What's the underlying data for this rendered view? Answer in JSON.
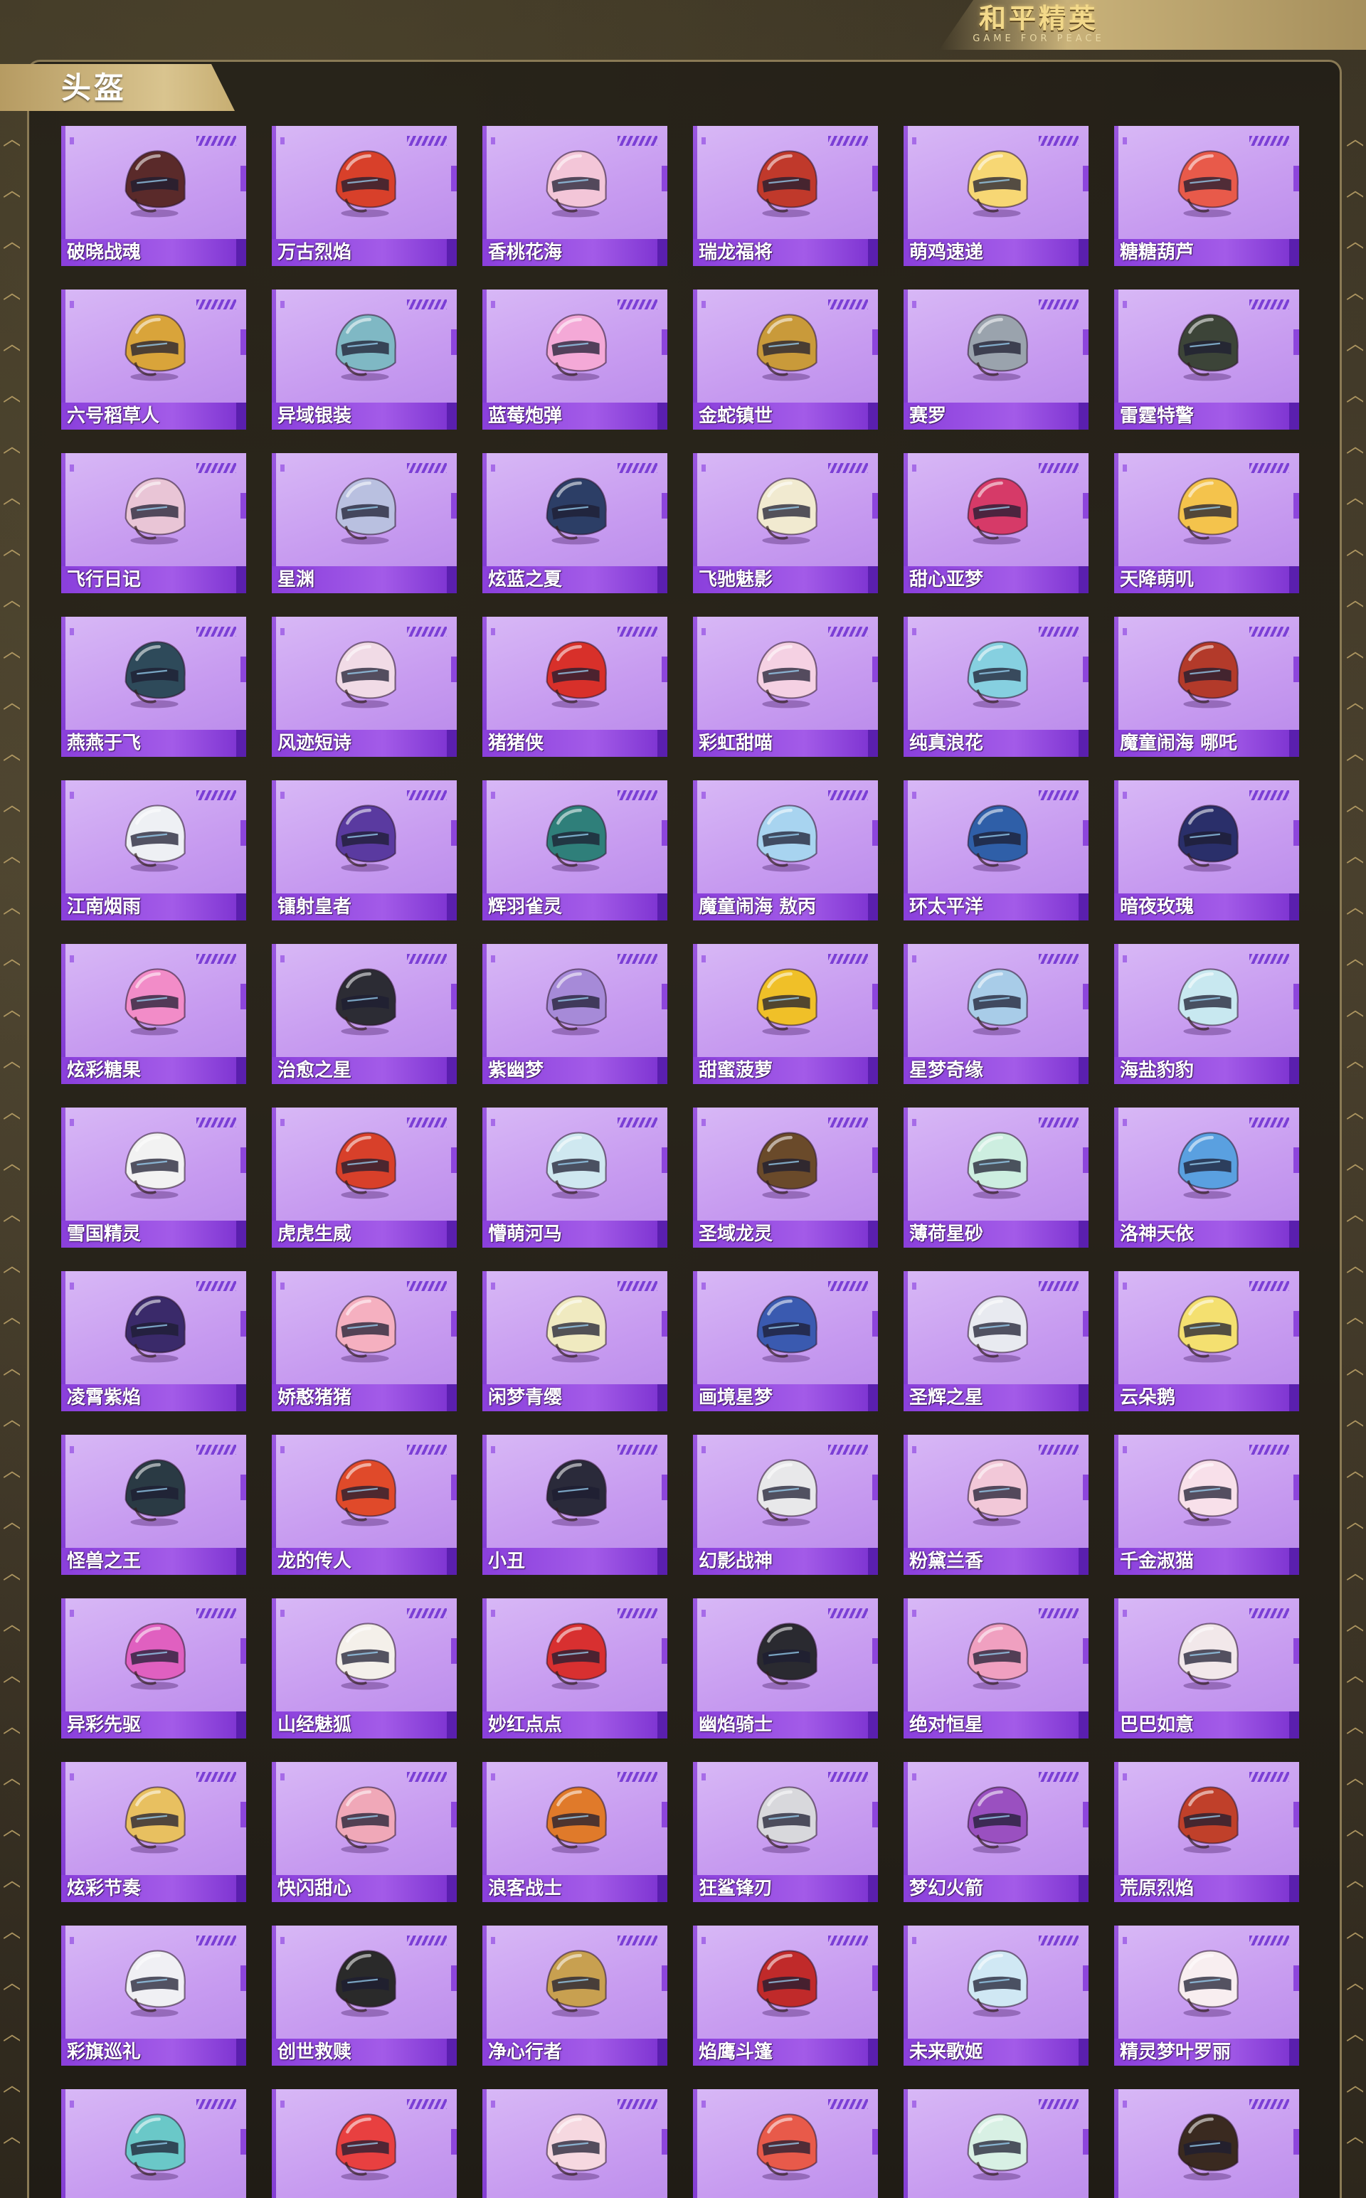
{
  "brand": {
    "name": "和平精英",
    "subtitle": "GAME FOR PEACE"
  },
  "section": {
    "title": "头盔"
  },
  "colors": {
    "card_bg": "#c99df0",
    "label_bar": "#9a4fe4",
    "tab_gold": "#d2bb84"
  },
  "items": [
    {
      "name": "破晓战魂",
      "color": "#5a2a2a"
    },
    {
      "name": "万古烈焰",
      "color": "#d8402a"
    },
    {
      "name": "香桃花海",
      "color": "#f3c6d8"
    },
    {
      "name": "瑞龙福将",
      "color": "#c0392b"
    },
    {
      "name": "萌鸡速递",
      "color": "#f7d774"
    },
    {
      "name": "糖糖葫芦",
      "color": "#e85a4a"
    },
    {
      "name": "六号稻草人",
      "color": "#d9a43a"
    },
    {
      "name": "异域银装",
      "color": "#7fb8c4"
    },
    {
      "name": "蓝莓炮弹",
      "color": "#f4a9d7"
    },
    {
      "name": "金蛇镇世",
      "color": "#c99a3a"
    },
    {
      "name": "赛罗",
      "color": "#9aa3ad"
    },
    {
      "name": "雷霆特警",
      "color": "#3c4438"
    },
    {
      "name": "飞行日记",
      "color": "#e9c5d6"
    },
    {
      "name": "星渊",
      "color": "#b9c0e0"
    },
    {
      "name": "炫蓝之夏",
      "color": "#2c3e66"
    },
    {
      "name": "飞驰魅影",
      "color": "#f1ead0"
    },
    {
      "name": "甜心亚梦",
      "color": "#d63a68"
    },
    {
      "name": "天降萌叽",
      "color": "#f4c34c"
    },
    {
      "name": "燕燕于飞",
      "color": "#2e4a5a"
    },
    {
      "name": "风迹短诗",
      "color": "#f1dbe6"
    },
    {
      "name": "猪猪侠",
      "color": "#d8302a"
    },
    {
      "name": "彩虹甜喵",
      "color": "#f5d1e3"
    },
    {
      "name": "纯真浪花",
      "color": "#86d0e0"
    },
    {
      "name": "魔童闹海 哪吒",
      "color": "#b33a2a"
    },
    {
      "name": "江南烟雨",
      "color": "#eef0f4"
    },
    {
      "name": "镭射皇者",
      "color": "#5a3aa0"
    },
    {
      "name": "辉羽雀灵",
      "color": "#2f7f7a"
    },
    {
      "name": "魔童闹海 敖丙",
      "color": "#a8d4f0"
    },
    {
      "name": "环太平洋",
      "color": "#2f5fa8"
    },
    {
      "name": "暗夜玫瑰",
      "color": "#2a2f6a"
    },
    {
      "name": "炫彩糖果",
      "color": "#f28cc8"
    },
    {
      "name": "治愈之星",
      "color": "#2c2c34"
    },
    {
      "name": "紫幽梦",
      "color": "#a68ad8"
    },
    {
      "name": "甜蜜菠萝",
      "color": "#f0c028"
    },
    {
      "name": "星梦奇缘",
      "color": "#a8cce8"
    },
    {
      "name": "海盐豹豹",
      "color": "#c8e8f0"
    },
    {
      "name": "雪国精灵",
      "color": "#f2f2f2"
    },
    {
      "name": "虎虎生威",
      "color": "#d8402a"
    },
    {
      "name": "懵萌河马",
      "color": "#cfe8f0"
    },
    {
      "name": "圣域龙灵",
      "color": "#6a4a2a"
    },
    {
      "name": "薄荷星砂",
      "color": "#cdeee0"
    },
    {
      "name": "洛神天依",
      "color": "#5aa0e0"
    },
    {
      "name": "凌霄紫焰",
      "color": "#3a2a6a"
    },
    {
      "name": "娇憨猪猪",
      "color": "#f5b0c0"
    },
    {
      "name": "闲梦青缨",
      "color": "#f0eac0"
    },
    {
      "name": "画境星梦",
      "color": "#3a5ab0"
    },
    {
      "name": "圣辉之星",
      "color": "#e8eaf0"
    },
    {
      "name": "云朵鹅",
      "color": "#f4e070"
    },
    {
      "name": "怪兽之王",
      "color": "#2a3a44"
    },
    {
      "name": "龙的传人",
      "color": "#e04a2a"
    },
    {
      "name": "小丑",
      "color": "#2a2a3a"
    },
    {
      "name": "幻影战神",
      "color": "#e8e8ea"
    },
    {
      "name": "粉黛兰香",
      "color": "#f2c8d8"
    },
    {
      "name": "千金淑猫",
      "color": "#f8e0ea"
    },
    {
      "name": "异彩先驱",
      "color": "#e060c0"
    },
    {
      "name": "山经魅狐",
      "color": "#f4f0ea"
    },
    {
      "name": "妙红点点",
      "color": "#d83030"
    },
    {
      "name": "幽焰骑士",
      "color": "#2a2a30"
    },
    {
      "name": "绝对恒星",
      "color": "#f0a0c0"
    },
    {
      "name": "巴巴如意",
      "color": "#f2e8ea"
    },
    {
      "name": "炫彩节奏",
      "color": "#e8c060"
    },
    {
      "name": "快闪甜心",
      "color": "#f0a8b8"
    },
    {
      "name": "浪客战士",
      "color": "#e07a2a"
    },
    {
      "name": "狂鲨锋刃",
      "color": "#d8d8dc"
    },
    {
      "name": "梦幻火箭",
      "color": "#9a50c0"
    },
    {
      "name": "荒原烈焰",
      "color": "#c0402a"
    },
    {
      "name": "彩旗巡礼",
      "color": "#f0f0f4"
    },
    {
      "name": "创世救赎",
      "color": "#2a2a2a"
    },
    {
      "name": "净心行者",
      "color": "#c8a050"
    },
    {
      "name": "焰鹰斗篷",
      "color": "#c02a2a"
    },
    {
      "name": "未来歌姬",
      "color": "#d0e8f4"
    },
    {
      "name": "精灵梦叶罗丽",
      "color": "#f8eef0"
    },
    {
      "name": "",
      "color": "#6ac8c8"
    },
    {
      "name": "",
      "color": "#e84040"
    },
    {
      "name": "",
      "color": "#f6d8e0"
    },
    {
      "name": "",
      "color": "#e85a4a"
    },
    {
      "name": "",
      "color": "#d8f0e4"
    },
    {
      "name": "",
      "color": "#3a2a20"
    }
  ]
}
